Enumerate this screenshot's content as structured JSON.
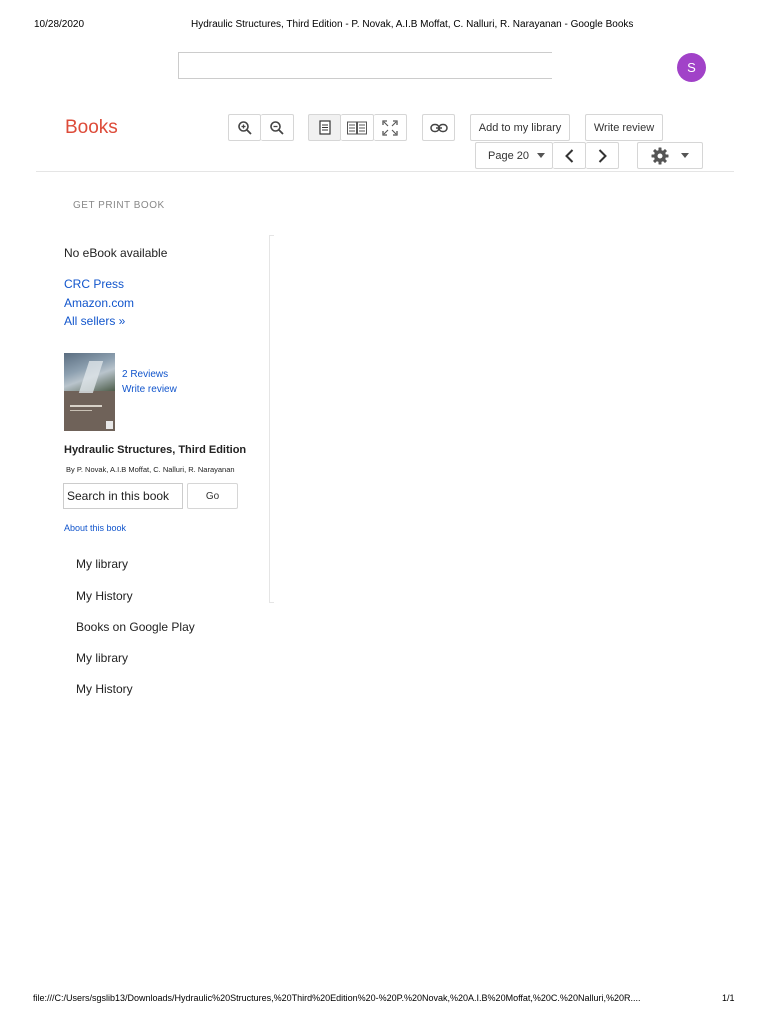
{
  "print_header": {
    "date": "10/28/2020",
    "title": "Hydraulic Structures, Third Edition - P. Novak, A.I.B Moffat, C. Nalluri, R. Narayanan - Google Books"
  },
  "account": {
    "initial": "S"
  },
  "logo": "Books",
  "toolbar": {
    "add_library": "Add to my library",
    "write_review": "Write review",
    "page": "Page 20"
  },
  "sidebar": {
    "get_print": "GET PRINT BOOK",
    "no_ebook": "No eBook available",
    "sellers": [
      "CRC Press",
      "Amazon.com",
      "All sellers »"
    ],
    "reviews": "2 Reviews",
    "write_review": "Write review",
    "book_title": "Hydraulic Structures, Third Edition",
    "authors": "By P. Novak, A.I.B Moffat, C. Nalluri, R. Narayanan",
    "search_value": "Search in this book",
    "go": "Go",
    "about": "About this book",
    "nav": [
      "My library",
      "My History",
      "Books on Google Play",
      "My library",
      "My History"
    ]
  },
  "print_footer": {
    "path": "file:///C:/Users/sgslib13/Downloads/Hydraulic%20Structures,%20Third%20Edition%20-%20P.%20Novak,%20A.I.B%20Moffat,%20C.%20Nalluri,%20R....",
    "page": "1/1"
  }
}
